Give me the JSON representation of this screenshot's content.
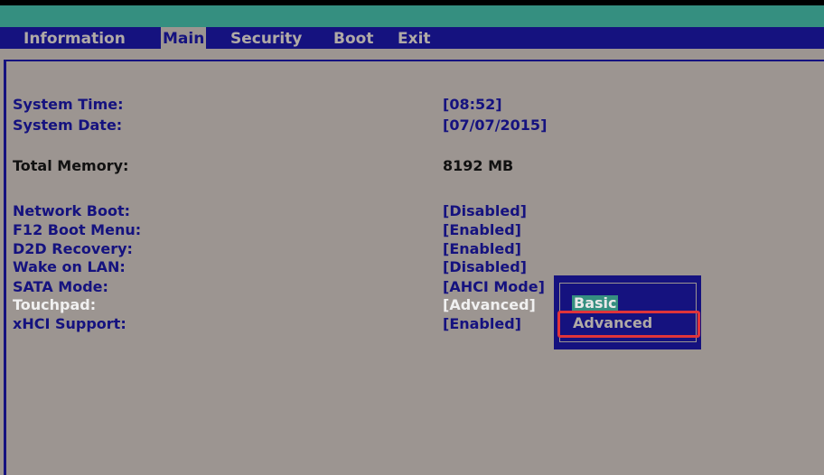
{
  "menu": {
    "tabs": [
      "Information",
      "Main",
      "Security",
      "Boot",
      "Exit"
    ],
    "active": "Main"
  },
  "fields": [
    {
      "label": "System Time:",
      "value": "[08:52]"
    },
    {
      "label": "System Date:",
      "value": "[07/07/2015]"
    },
    {
      "label": "Total Memory:",
      "value": "8192 MB"
    },
    {
      "label": "Network Boot:",
      "value": "[Disabled]"
    },
    {
      "label": "F12 Boot Menu:",
      "value": "[Enabled]"
    },
    {
      "label": "D2D Recovery:",
      "value": "[Enabled]"
    },
    {
      "label": "Wake on LAN:",
      "value": "[Disabled]"
    },
    {
      "label": "SATA Mode:",
      "value": "[AHCI Mode]"
    },
    {
      "label": "Touchpad:",
      "value": "[Advanced]"
    },
    {
      "label": "xHCI Support:",
      "value": "[Enabled]"
    }
  ],
  "popup": {
    "options": [
      "Basic",
      "Advanced"
    ]
  },
  "colors": {
    "background": "#9c9591",
    "navy": "#15127f",
    "teal": "#358f80",
    "highlight": "#e0343a"
  }
}
